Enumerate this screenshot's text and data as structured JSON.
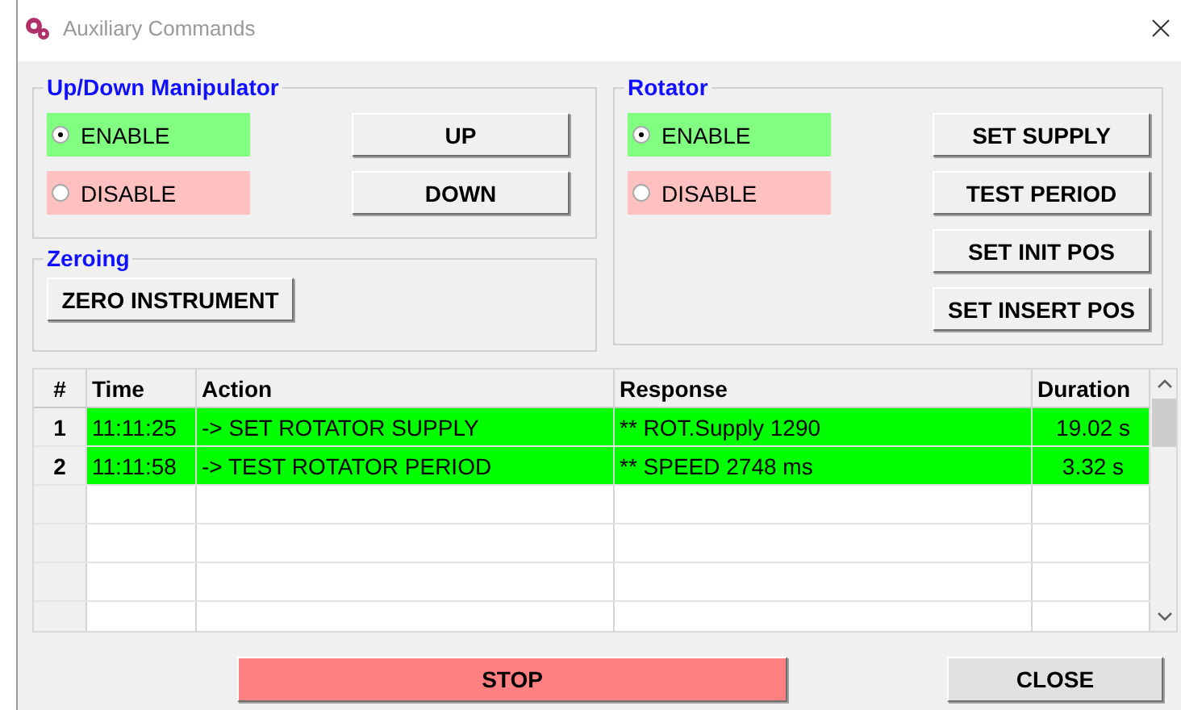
{
  "window": {
    "title": "Auxiliary Commands"
  },
  "manipulator": {
    "title": "Up/Down Manipulator",
    "options": [
      {
        "label": "ENABLE",
        "selected": true,
        "color": "#80ff80"
      },
      {
        "label": "DISABLE",
        "selected": false,
        "color": "#ffc0c0"
      }
    ],
    "buttons": [
      "UP",
      "DOWN"
    ]
  },
  "zeroing": {
    "title": "Zeroing",
    "buttons": [
      "ZERO INSTRUMENT"
    ]
  },
  "rotator": {
    "title": "Rotator",
    "options": [
      {
        "label": "ENABLE",
        "selected": true,
        "color": "#80ff80"
      },
      {
        "label": "DISABLE",
        "selected": false,
        "color": "#ffc0c0"
      }
    ],
    "buttons": [
      "SET SUPPLY",
      "TEST PERIOD",
      "SET INIT POS",
      "SET INSERT POS"
    ]
  },
  "table": {
    "columns": [
      "#",
      "Time",
      "Action",
      "Response",
      "Duration"
    ],
    "rows": [
      {
        "cells": [
          "1",
          "11:11:25",
          "-> SET ROTATOR SUPPLY",
          "** ROT.Supply 1290",
          "19.02 s"
        ],
        "color": "#00ff00"
      },
      {
        "cells": [
          "2",
          "11:11:58",
          "-> TEST ROTATOR PERIOD",
          "** SPEED 2748 ms",
          "3.32 s"
        ],
        "color": "#00ff00"
      }
    ]
  },
  "buttons": [
    {
      "label": "STOP",
      "color": "#ff8080"
    },
    {
      "label": "CLOSE",
      "color": "#e1e1e1"
    }
  ]
}
